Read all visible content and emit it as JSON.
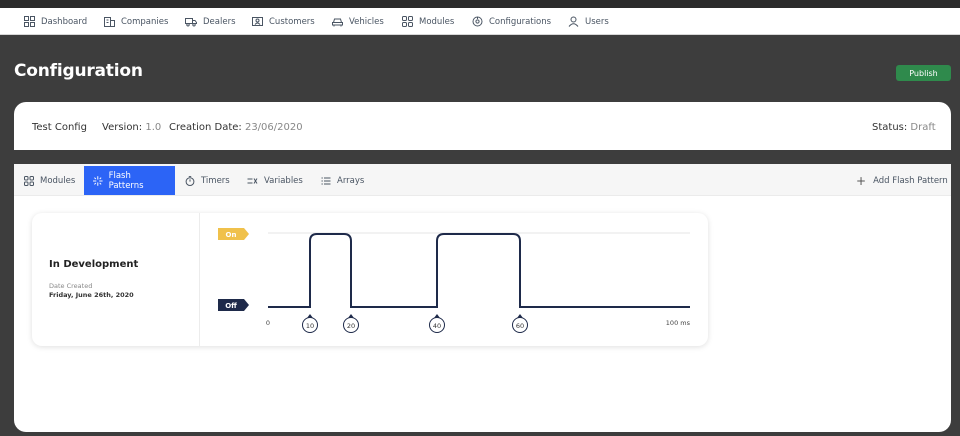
{
  "nav": {
    "items": [
      {
        "label": "Dashboard",
        "icon": "dashboard-icon"
      },
      {
        "label": "Companies",
        "icon": "building-icon"
      },
      {
        "label": "Dealers",
        "icon": "truck-icon"
      },
      {
        "label": "Customers",
        "icon": "id-card-icon"
      },
      {
        "label": "Vehicles",
        "icon": "car-icon"
      },
      {
        "label": "Modules",
        "icon": "modules-icon"
      },
      {
        "label": "Configurations",
        "icon": "settings-icon"
      },
      {
        "label": "Users",
        "icon": "user-icon"
      }
    ]
  },
  "page": {
    "title": "Configuration",
    "publish_label": "Publish",
    "publish_color": "#2f8a4c"
  },
  "config": {
    "name": "Test Config",
    "version_label": "Version:",
    "version_value": "1.0",
    "creation_label": "Creation Date:",
    "creation_value": "23/06/2020",
    "status_label": "Status:",
    "status_value": "Draft"
  },
  "tabs": {
    "items": [
      {
        "label": "Modules",
        "icon": "modules-icon",
        "active": false
      },
      {
        "label": "Flash Patterns",
        "icon": "sparkle-icon",
        "active": true
      },
      {
        "label": "Timers",
        "icon": "stopwatch-icon",
        "active": false
      },
      {
        "label": "Variables",
        "icon": "variables-icon",
        "active": false
      },
      {
        "label": "Arrays",
        "icon": "list-icon",
        "active": false
      }
    ],
    "add_label": "Add Flash Pattern",
    "active_color": "#2c64f6"
  },
  "pattern": {
    "name": "In Development",
    "date_label": "Date Created",
    "date_value": "Friday, June 26th, 2020",
    "on_label": "On",
    "off_label": "Off",
    "axis_start": "0",
    "axis_end": "100 ms",
    "markers": [
      "10",
      "20",
      "40",
      "60"
    ],
    "on_color": "#f0c14b",
    "off_color": "#1e2a4a"
  }
}
